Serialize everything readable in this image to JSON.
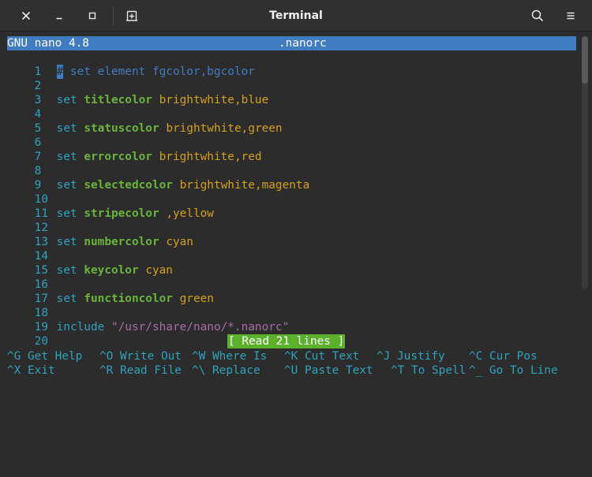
{
  "window": {
    "title": "Terminal"
  },
  "nano": {
    "version": "GNU nano 4.8",
    "filename": ".nanorc",
    "lines": [
      {
        "num": "1",
        "cursor": "#",
        "comment": " set element fgcolor,bgcolor"
      },
      {
        "num": "2"
      },
      {
        "num": "3",
        "set": "set",
        "name": "titlecolor",
        "value": "brightwhite,blue"
      },
      {
        "num": "4"
      },
      {
        "num": "5",
        "set": "set",
        "name": "statuscolor",
        "value": "brightwhite,green"
      },
      {
        "num": "6"
      },
      {
        "num": "7",
        "set": "set",
        "name": "errorcolor",
        "value": "brightwhite,red"
      },
      {
        "num": "8"
      },
      {
        "num": "9",
        "set": "set",
        "name": "selectedcolor",
        "value": "brightwhite,magenta"
      },
      {
        "num": "10"
      },
      {
        "num": "11",
        "set": "set",
        "name": "stripecolor",
        "value": ",yellow"
      },
      {
        "num": "12"
      },
      {
        "num": "13",
        "set": "set",
        "name": "numbercolor",
        "value": "cyan"
      },
      {
        "num": "14"
      },
      {
        "num": "15",
        "set": "set",
        "name": "keycolor",
        "value": "cyan"
      },
      {
        "num": "16"
      },
      {
        "num": "17",
        "set": "set",
        "name": "functioncolor",
        "value": "green"
      },
      {
        "num": "18"
      },
      {
        "num": "19",
        "set": "include",
        "string": "\"/usr/share/nano/*.nanorc\""
      },
      {
        "num": "20"
      }
    ],
    "status": "[ Read 21 lines ]",
    "shortcuts": [
      [
        {
          "key": "^G",
          "label": "Get Help"
        },
        {
          "key": "^O",
          "label": "Write Out"
        },
        {
          "key": "^W",
          "label": "Where Is"
        },
        {
          "key": "^K",
          "label": "Cut Text"
        },
        {
          "key": "^J",
          "label": "Justify"
        },
        {
          "key": "^C",
          "label": "Cur Pos"
        }
      ],
      [
        {
          "key": "^X",
          "label": "Exit"
        },
        {
          "key": "^R",
          "label": "Read File"
        },
        {
          "key": "^\\",
          "label": "Replace"
        },
        {
          "key": "^U",
          "label": "Paste Text"
        },
        {
          "key": "^T",
          "label": "To Spell"
        },
        {
          "key": "^_",
          "label": "Go To Line"
        }
      ]
    ]
  },
  "colors": {
    "title_bar_bg": "#3f7cc2",
    "line_number": "#2ea3bb",
    "keyword": "#6ab43a",
    "value": "#d4a017",
    "string": "#a56ea3",
    "status_bg": "#5bb02c"
  },
  "icons": {
    "close": "close-icon",
    "minimize": "minimize-icon",
    "maximize": "maximize-icon",
    "new_tab": "new-tab-icon",
    "search": "search-icon",
    "menu": "hamburger-menu-icon"
  }
}
